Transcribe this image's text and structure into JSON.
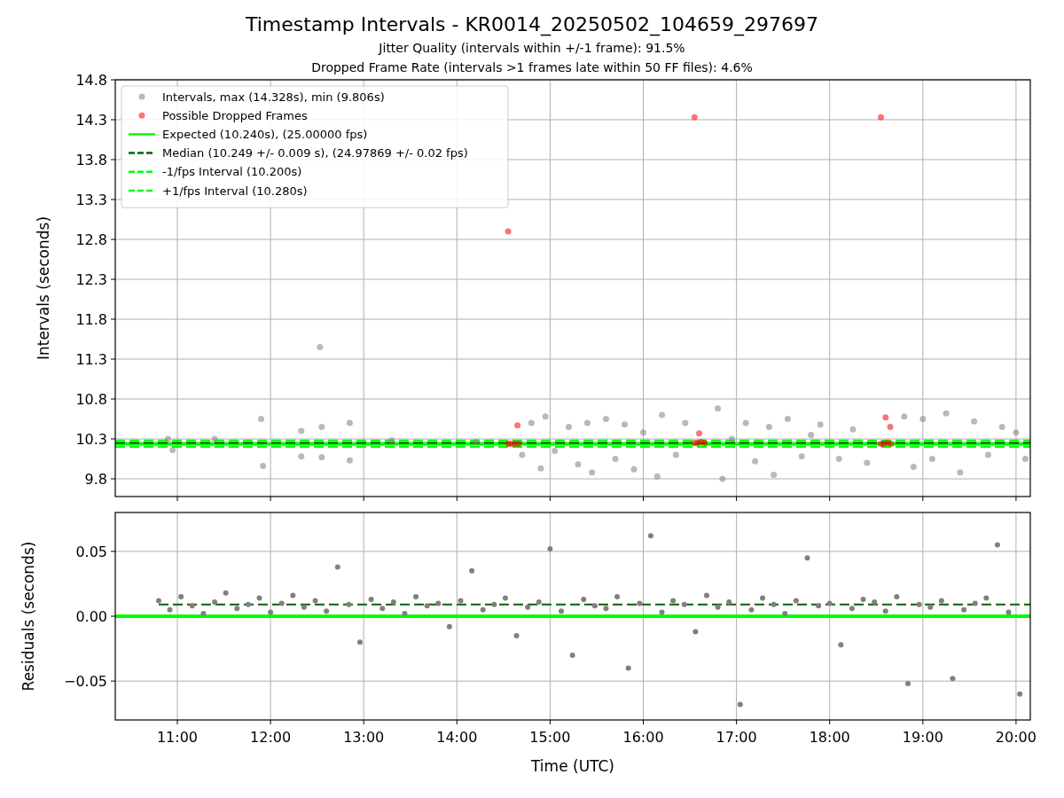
{
  "figure": {
    "title": "Timestamp Intervals - KR0014_20250502_104659_297697",
    "subtitles": [
      "Jitter Quality (intervals within +/-1 frame): 91.5%",
      "Dropped Frame Rate (intervals >1 frames late within 50 FF files): 4.6%"
    ]
  },
  "intervals_plot": {
    "chart_data": {
      "type": "scatter",
      "grid": true,
      "legend": true,
      "ylabel": "Intervals (seconds)",
      "xlim": [
        10.334,
        20.153
      ],
      "ylim": [
        9.578,
        14.8
      ],
      "yticks": [
        {
          "value": 9.8,
          "label": "9.8"
        },
        {
          "value": 10.3,
          "label": "10.3"
        },
        {
          "value": 10.8,
          "label": "10.8"
        },
        {
          "value": 11.3,
          "label": "11.3"
        },
        {
          "value": 11.8,
          "label": "11.8"
        },
        {
          "value": 12.3,
          "label": "12.3"
        },
        {
          "value": 12.8,
          "label": "12.8"
        },
        {
          "value": 13.3,
          "label": "13.3"
        },
        {
          "value": 13.8,
          "label": "13.8"
        },
        {
          "value": 14.3,
          "label": "14.3"
        },
        {
          "value": 14.8,
          "label": "14.8"
        }
      ],
      "series": [
        {
          "name": "Intervals, max (14.328s), min (9.806s)",
          "color": "#808080",
          "type": "scatter",
          "x": [
            10.9,
            10.95,
            11.4,
            11.9,
            11.92,
            12.33,
            12.33,
            12.53,
            12.55,
            12.55,
            12.85,
            12.85,
            13.3,
            14.2,
            14.7,
            14.8,
            14.9,
            14.95,
            15.05,
            15.2,
            15.3,
            15.4,
            15.45,
            15.6,
            15.7,
            15.8,
            15.9,
            16.0,
            16.15,
            16.2,
            16.35,
            16.45,
            16.8,
            16.85,
            16.95,
            17.1,
            17.2,
            17.35,
            17.4,
            17.55,
            17.7,
            17.8,
            17.9,
            18.1,
            18.25,
            18.4,
            18.8,
            18.9,
            19.0,
            19.1,
            19.25,
            19.4,
            19.55,
            19.7,
            19.85,
            20.0,
            20.1
          ],
          "values": [
            10.3,
            10.16,
            10.3,
            10.55,
            9.96,
            10.4,
            10.08,
            11.45,
            10.45,
            10.07,
            10.5,
            10.03,
            10.28,
            10.26,
            10.1,
            10.5,
            9.93,
            10.58,
            10.15,
            10.45,
            9.98,
            10.5,
            9.88,
            10.55,
            10.05,
            10.48,
            9.92,
            10.38,
            9.83,
            10.6,
            10.1,
            10.5,
            10.68,
            9.8,
            10.3,
            10.5,
            10.02,
            10.45,
            9.85,
            10.55,
            10.08,
            10.35,
            10.48,
            10.05,
            10.42,
            10.0,
            10.58,
            9.95,
            10.55,
            10.05,
            10.62,
            9.88,
            10.52,
            10.1,
            10.45,
            10.38,
            10.05
          ]
        },
        {
          "name": "Possible Dropped Frames",
          "color": "#ff0000",
          "type": "scatter",
          "x": [
            14.55,
            14.58,
            14.62,
            14.66,
            14.55,
            14.65,
            16.55,
            16.58,
            16.62,
            16.66,
            16.6,
            16.55,
            18.55,
            18.58,
            18.62,
            18.66,
            18.6,
            18.65,
            18.55
          ],
          "values": [
            10.24,
            10.24,
            10.24,
            10.24,
            12.9,
            10.47,
            10.25,
            10.25,
            10.26,
            10.25,
            10.37,
            14.33,
            10.24,
            10.24,
            10.25,
            10.24,
            10.57,
            10.45,
            14.33
          ]
        },
        {
          "name": "Expected (10.240s), (25.00000 fps)",
          "color": "#00ff00",
          "type": "line",
          "line_style": "solid",
          "x": [
            10.334,
            20.153
          ],
          "values": [
            10.24,
            10.24
          ]
        },
        {
          "name": "Median (10.249 +/- 0.009 s), (24.97869 +/- 0.02 fps)",
          "color": "#006400",
          "type": "line",
          "line_style": "dashed",
          "x": [
            10.334,
            20.153
          ],
          "values": [
            10.25,
            10.25
          ]
        },
        {
          "name": "-1/fps Interval (10.200s)",
          "color": "#00ff00",
          "type": "line",
          "line_style": "dashed",
          "x": [
            10.334,
            20.153
          ],
          "values": [
            10.2,
            10.2
          ]
        },
        {
          "name": "+1/fps Interval (10.280s)",
          "color": "#00ff00",
          "type": "line",
          "line_style": "dashed",
          "x": [
            10.334,
            20.153
          ],
          "values": [
            10.28,
            10.28
          ]
        }
      ]
    }
  },
  "residuals_plot": {
    "chart_data": {
      "type": "scatter",
      "grid": true,
      "xlabel": "Time (UTC)",
      "ylabel": "Residuals (seconds)",
      "xlim": [
        10.334,
        20.153
      ],
      "ylim": [
        -0.08,
        0.08
      ],
      "xticks": [
        {
          "value": 11,
          "label": "11:00"
        },
        {
          "value": 12,
          "label": "12:00"
        },
        {
          "value": 13,
          "label": "13:00"
        },
        {
          "value": 14,
          "label": "14:00"
        },
        {
          "value": 15,
          "label": "15:00"
        },
        {
          "value": 16,
          "label": "16:00"
        },
        {
          "value": 17,
          "label": "17:00"
        },
        {
          "value": 18,
          "label": "18:00"
        },
        {
          "value": 19,
          "label": "19:00"
        },
        {
          "value": 20,
          "label": "20:00"
        }
      ],
      "yticks": [
        {
          "value": -0.05,
          "label": "−0.05"
        },
        {
          "value": 0,
          "label": "0.00"
        },
        {
          "value": 0.05,
          "label": "0.05"
        }
      ],
      "series": [
        {
          "color": "#00ff00",
          "type": "line",
          "line_style": "solid",
          "x": [
            10.334,
            20.153
          ],
          "values": [
            0,
            0
          ]
        },
        {
          "color": "#006400",
          "type": "line",
          "line_style": "dashed",
          "x": [
            10.8,
            20.153
          ],
          "values": [
            0.009,
            0.009
          ]
        },
        {
          "color": "#808080",
          "type": "scatter",
          "x": [
            10.8,
            10.92,
            11.04,
            11.16,
            11.28,
            11.4,
            11.52,
            11.64,
            11.76,
            11.88,
            12.0,
            12.12,
            12.24,
            12.36,
            12.48,
            12.6,
            12.72,
            12.84,
            12.96,
            13.08,
            13.2,
            13.32,
            13.44,
            13.56,
            13.68,
            13.8,
            13.92,
            14.04,
            14.16,
            14.28,
            14.4,
            14.52,
            14.64,
            14.76,
            14.88,
            15.0,
            15.12,
            15.24,
            15.36,
            15.48,
            15.6,
            15.72,
            15.84,
            15.96,
            16.08,
            16.2,
            16.32,
            16.44,
            16.56,
            16.68,
            16.8,
            16.92,
            17.04,
            17.16,
            17.28,
            17.4,
            17.52,
            17.64,
            17.76,
            17.88,
            18.0,
            18.12,
            18.24,
            18.36,
            18.48,
            18.6,
            18.72,
            18.84,
            18.96,
            19.08,
            19.2,
            19.32,
            19.44,
            19.56,
            19.68,
            19.8,
            19.92,
            20.04
          ],
          "values": [
            0.012,
            0.005,
            0.015,
            0.008,
            0.002,
            0.011,
            0.018,
            0.006,
            0.009,
            0.014,
            0.003,
            0.01,
            0.016,
            0.007,
            0.012,
            0.004,
            0.038,
            0.009,
            -0.02,
            0.013,
            0.006,
            0.011,
            0.002,
            0.015,
            0.008,
            0.01,
            -0.008,
            0.012,
            0.035,
            0.005,
            0.009,
            0.014,
            -0.015,
            0.007,
            0.011,
            0.052,
            0.004,
            -0.03,
            0.013,
            0.008,
            0.006,
            0.015,
            -0.04,
            0.01,
            0.062,
            0.003,
            0.012,
            0.009,
            -0.012,
            0.016,
            0.007,
            0.011,
            -0.068,
            0.005,
            0.014,
            0.009,
            0.002,
            0.012,
            0.045,
            0.008,
            0.01,
            -0.022,
            0.006,
            0.013,
            0.011,
            0.004,
            0.015,
            -0.052,
            0.009,
            0.007,
            0.012,
            -0.048,
            0.005,
            0.01,
            0.014,
            0.055,
            0.003,
            -0.06
          ]
        }
      ]
    }
  }
}
